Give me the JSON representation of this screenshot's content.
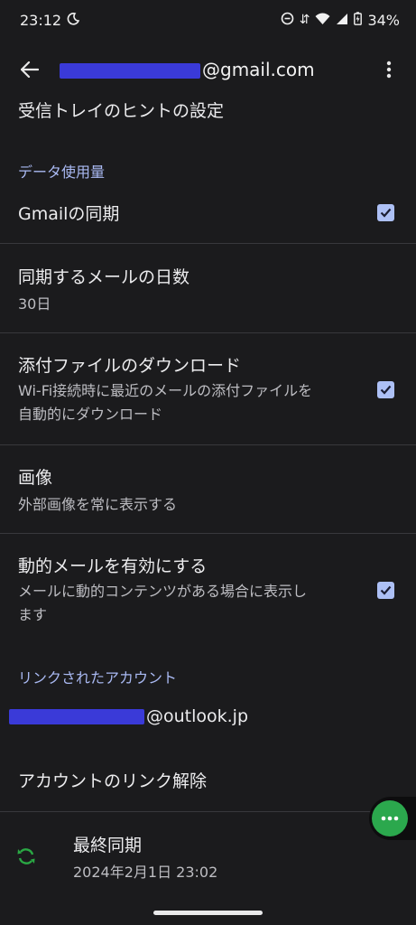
{
  "status": {
    "time": "23:12",
    "battery": "34%"
  },
  "header": {
    "email_suffix": "@gmail.com"
  },
  "inbox_tips": {
    "label": "受信トレイのヒントの設定"
  },
  "section_data": {
    "label": "データ使用量"
  },
  "gmail_sync": {
    "label": "Gmailの同期",
    "checked": true
  },
  "sync_days": {
    "label": "同期するメールの日数",
    "value": "30日"
  },
  "attachments": {
    "label": "添付ファイルのダウンロード",
    "desc_line1": "Wi-Fi接続時に最近のメールの添付ファイルを",
    "desc_line2": "自動的にダウンロード",
    "checked": true
  },
  "images": {
    "label": "画像",
    "value": "外部画像を常に表示する"
  },
  "dynamic_mail": {
    "label": "動的メールを有効にする",
    "desc_line1": "メールに動的コンテンツがある場合に表示し",
    "desc_line2": "ます",
    "checked": true
  },
  "section_linked": {
    "label": "リンクされたアカウント"
  },
  "linked_account": {
    "email_suffix": "@outlook.jp"
  },
  "unlink": {
    "label": "アカウントのリンク解除"
  },
  "last_sync": {
    "label": "最終同期",
    "value": "2024年2月1日 23:02"
  },
  "colors": {
    "accent": "#a9b9f2",
    "checkbox": "#adc0f5",
    "fab": "#2ba84d",
    "sync_icon": "#2aa844",
    "redaction": "#3a3ad8"
  }
}
